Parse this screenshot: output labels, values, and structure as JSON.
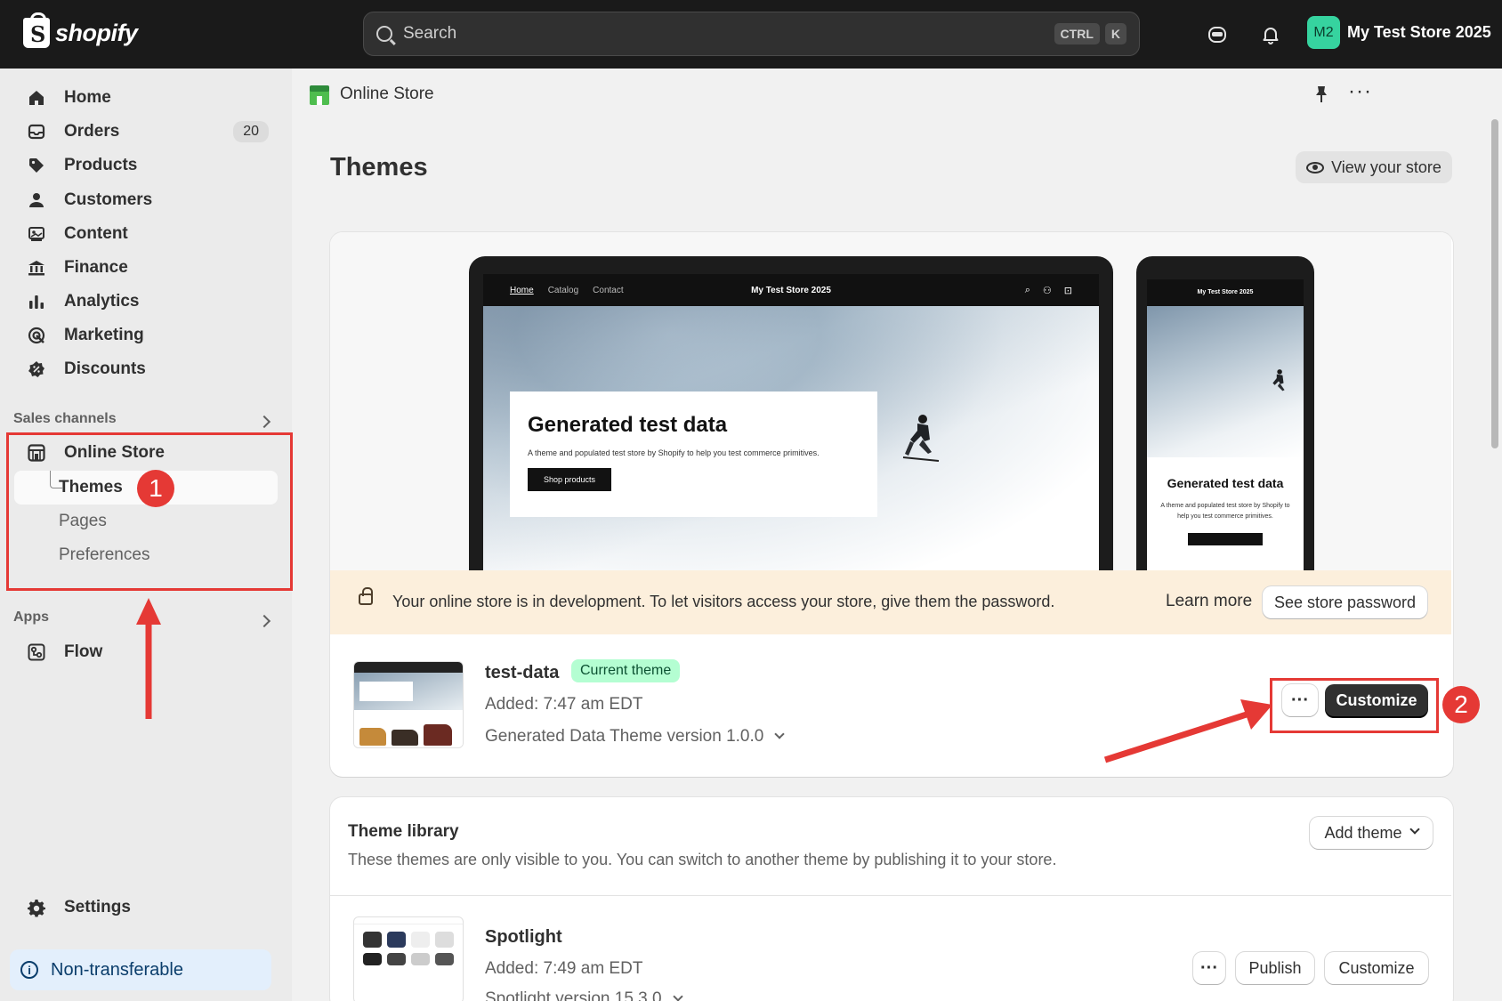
{
  "topbar": {
    "brand": "shopify",
    "search_placeholder": "Search",
    "shortcut_key1": "CTRL",
    "shortcut_key2": "K",
    "avatar_initials": "M2",
    "store_name": "My Test Store 2025"
  },
  "sidebar": {
    "items": [
      {
        "label": "Home",
        "icon": "home-icon"
      },
      {
        "label": "Orders",
        "icon": "orders-icon",
        "count": "20"
      },
      {
        "label": "Products",
        "icon": "tag-icon"
      },
      {
        "label": "Customers",
        "icon": "person-icon"
      },
      {
        "label": "Content",
        "icon": "content-icon"
      },
      {
        "label": "Finance",
        "icon": "bank-icon"
      },
      {
        "label": "Analytics",
        "icon": "bar-chart-icon"
      },
      {
        "label": "Marketing",
        "icon": "target-icon"
      },
      {
        "label": "Discounts",
        "icon": "discount-icon"
      }
    ],
    "sales_channels_label": "Sales channels",
    "online_store_label": "Online Store",
    "sub_items": [
      "Themes",
      "Pages",
      "Preferences"
    ],
    "apps_label": "Apps",
    "flow_label": "Flow",
    "settings_label": "Settings",
    "non_transferable_label": "Non-transferable"
  },
  "annotations": {
    "one": "1",
    "two": "2"
  },
  "header": {
    "title": "Online Store"
  },
  "page": {
    "title": "Themes",
    "view_store_label": "View your store"
  },
  "preview": {
    "nav_links": [
      "Home",
      "Catalog",
      "Contact"
    ],
    "store_brand": "My Test Store 2025",
    "phone_brand": "My Test Store 2025",
    "hero_title": "Generated test data",
    "hero_desc": "A theme and populated test store by Shopify to help you test commerce primitives.",
    "hero_button": "Shop products",
    "phone_title": "Generated test data",
    "phone_desc": "A theme and populated test store by Shopify to help you test commerce primitives."
  },
  "banner": {
    "text": "Your online store is in development. To let visitors access your store, give them the password.",
    "learn_more": "Learn more",
    "button": "See store password"
  },
  "current_theme": {
    "name": "test-data",
    "badge": "Current theme",
    "added": "Added: 7:47 am EDT",
    "version": "Generated Data Theme version 1.0.0",
    "more_label": "···",
    "customize_label": "Customize"
  },
  "library": {
    "title": "Theme library",
    "description": "These themes are only visible to you. You can switch to another theme by publishing it to your store.",
    "add_theme_label": "Add theme",
    "themes": [
      {
        "name": "Spotlight",
        "added": "Added: 7:49 am EDT",
        "version": "Spotlight version 15.3.0",
        "more_label": "···",
        "publish_label": "Publish",
        "customize_label": "Customize"
      }
    ]
  },
  "colors": {
    "topbar": "#1a1a1a",
    "annotation": "#e53935",
    "current_badge_bg": "#b4fed2",
    "banner_bg": "#fcefdc",
    "avatar_bg": "#36d39f"
  }
}
